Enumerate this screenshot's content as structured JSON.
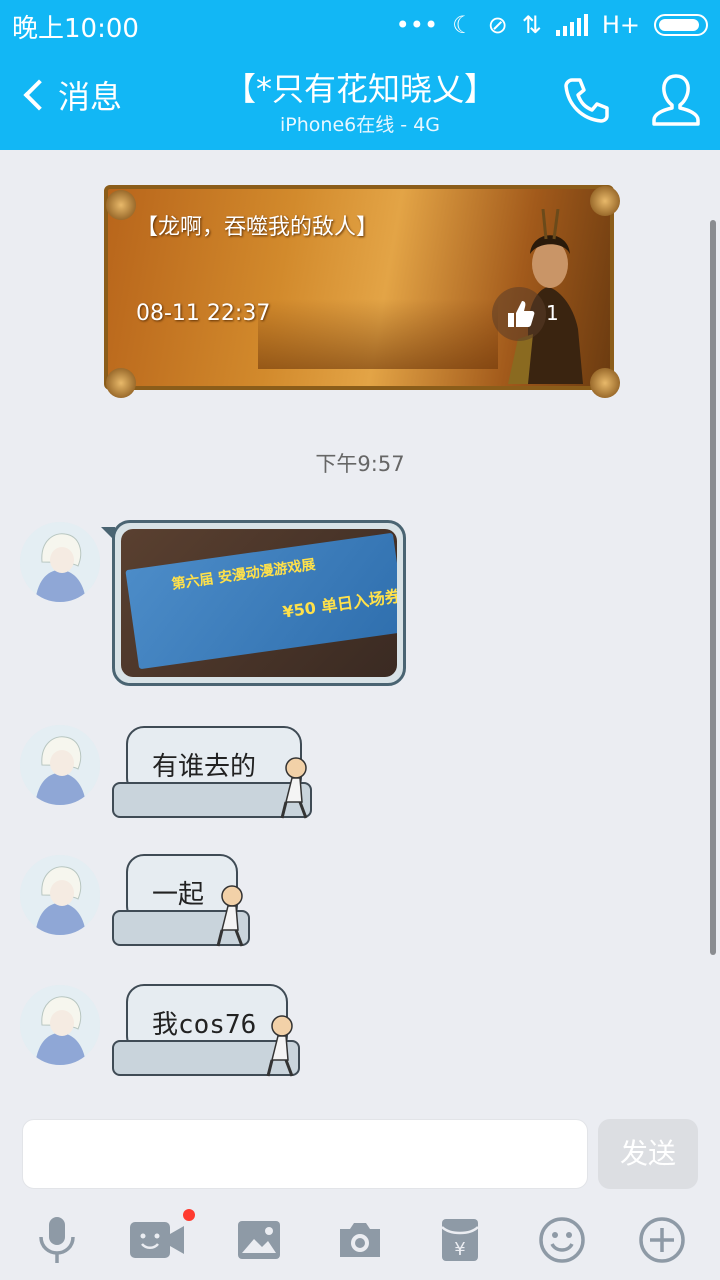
{
  "status_bar": {
    "time": "晚上10:00",
    "network": "H+"
  },
  "header": {
    "back_label": "消息",
    "title": "【*只有花知晓乂】",
    "subtitle": "iPhone6在线 - 4G"
  },
  "banner": {
    "title": "【龙啊，吞噬我的敌人】",
    "date": "08-11 22:37",
    "like_count": "1"
  },
  "timestamp": "下午9:57",
  "messages": [
    {
      "type": "image",
      "ticket_line1": "第六届 安漫动漫游戏展",
      "ticket_price": "¥50 单日入场券"
    },
    {
      "type": "text",
      "text": "有谁去的"
    },
    {
      "type": "text",
      "text": "一起"
    },
    {
      "type": "text",
      "text": "我cos76"
    }
  ],
  "input": {
    "placeholder": "",
    "send_label": "发送"
  },
  "toolbar": [
    "mic-icon",
    "video-icon",
    "image-icon",
    "camera-icon",
    "red-packet-icon",
    "emoji-icon",
    "plus-icon"
  ],
  "colors": {
    "accent": "#12b7f5",
    "background": "#ebedf2",
    "badge": "#ff3b30"
  }
}
